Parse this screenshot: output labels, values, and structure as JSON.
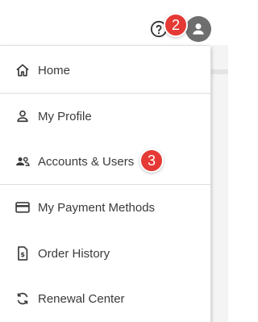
{
  "header": {
    "help_icon": "help-circle-icon",
    "avatar_icon": "person-icon",
    "badge_top": "2"
  },
  "menu": {
    "items": [
      {
        "label": "Home",
        "icon": "home-icon"
      },
      {
        "label": "My Profile",
        "icon": "person-outline-icon"
      },
      {
        "label": "Accounts & Users",
        "icon": "people-icon"
      },
      {
        "label": "My Payment Methods",
        "icon": "credit-card-icon"
      },
      {
        "label": "Order History",
        "icon": "receipt-dollar-icon"
      },
      {
        "label": "Renewal Center",
        "icon": "refresh-icon"
      }
    ],
    "badge_accounts": "3"
  },
  "colors": {
    "badge": "#e53935",
    "avatar": "#6e6e6e",
    "icon": "#3a3a3a"
  }
}
